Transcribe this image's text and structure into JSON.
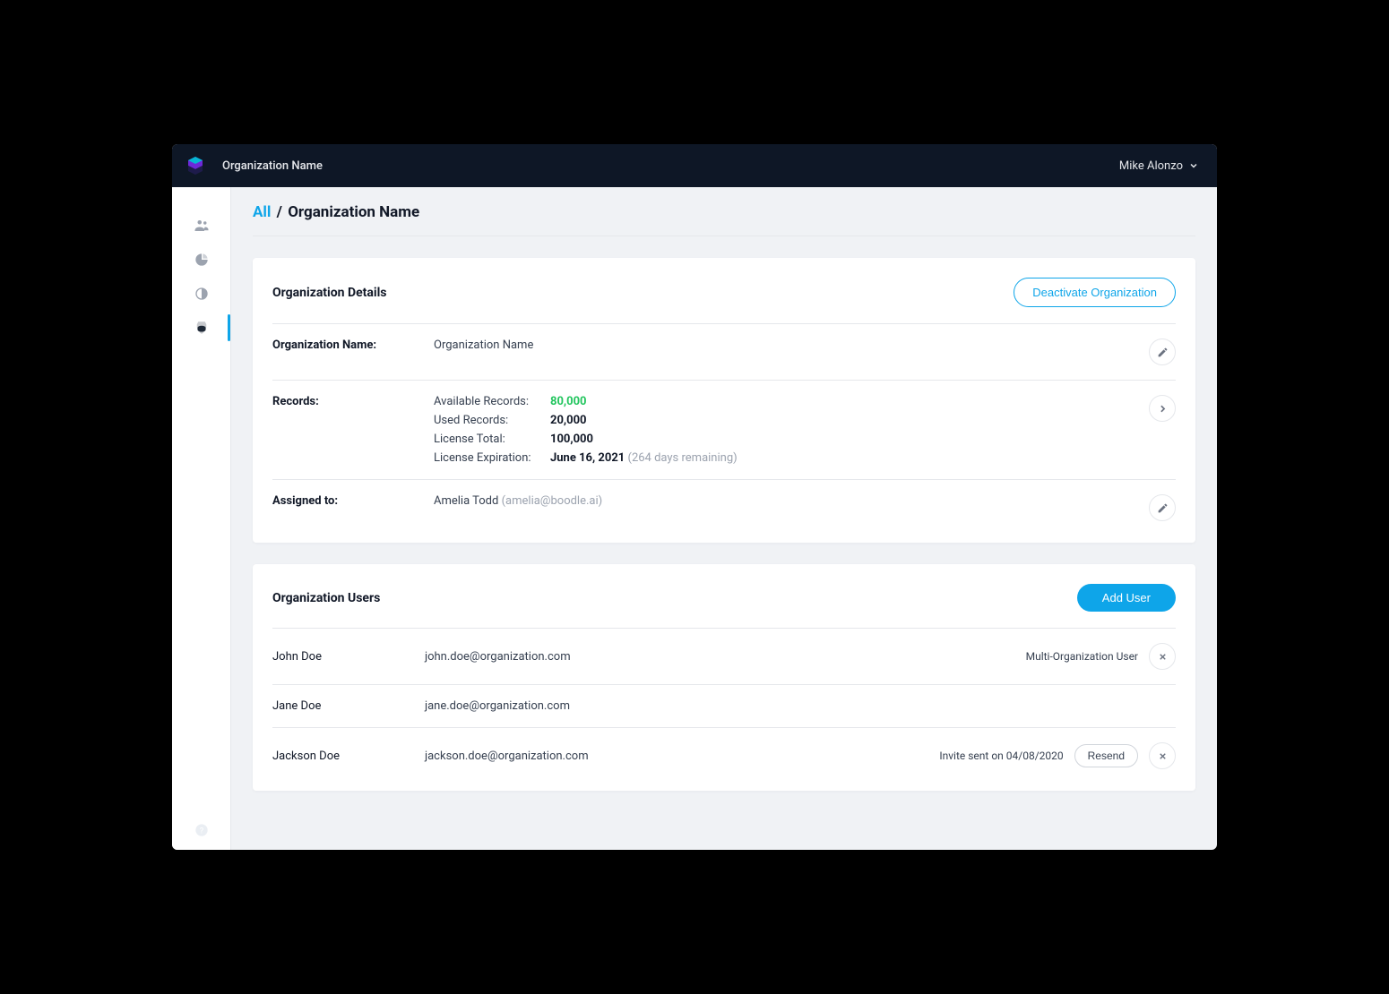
{
  "header": {
    "org_name": "Organization Name",
    "user_name": "Mike Alonzo"
  },
  "breadcrumb": {
    "root": "All",
    "sep": "/",
    "current": "Organization Name"
  },
  "details": {
    "card_title": "Organization Details",
    "deactivate_label": "Deactivate Organization",
    "name_label": "Organization Name:",
    "name_value": "Organization Name",
    "records_label": "Records:",
    "records": {
      "available_label": "Available Records:",
      "available_value": "80,000",
      "used_label": "Used Records:",
      "used_value": "20,000",
      "total_label": "License Total:",
      "total_value": "100,000",
      "expiration_label": "License Expiration:",
      "expiration_value": "June 16, 2021",
      "expiration_remaining": "(264 days remaining)"
    },
    "assigned_label": "Assigned to:",
    "assigned_name": "Amelia Todd",
    "assigned_email": "(amelia@boodle.ai)"
  },
  "users_card": {
    "title": "Organization Users",
    "add_label": "Add User",
    "resend_label": "Resend",
    "rows": [
      {
        "name": "John Doe",
        "email": "john.doe@organization.com",
        "meta": "Multi-Organization User",
        "resend": false
      },
      {
        "name": "Jane Doe",
        "email": "jane.doe@organization.com",
        "meta": "",
        "resend": false
      },
      {
        "name": "Jackson Doe",
        "email": "jackson.doe@organization.com",
        "meta": "Invite sent on 04/08/2020",
        "resend": true
      }
    ]
  }
}
